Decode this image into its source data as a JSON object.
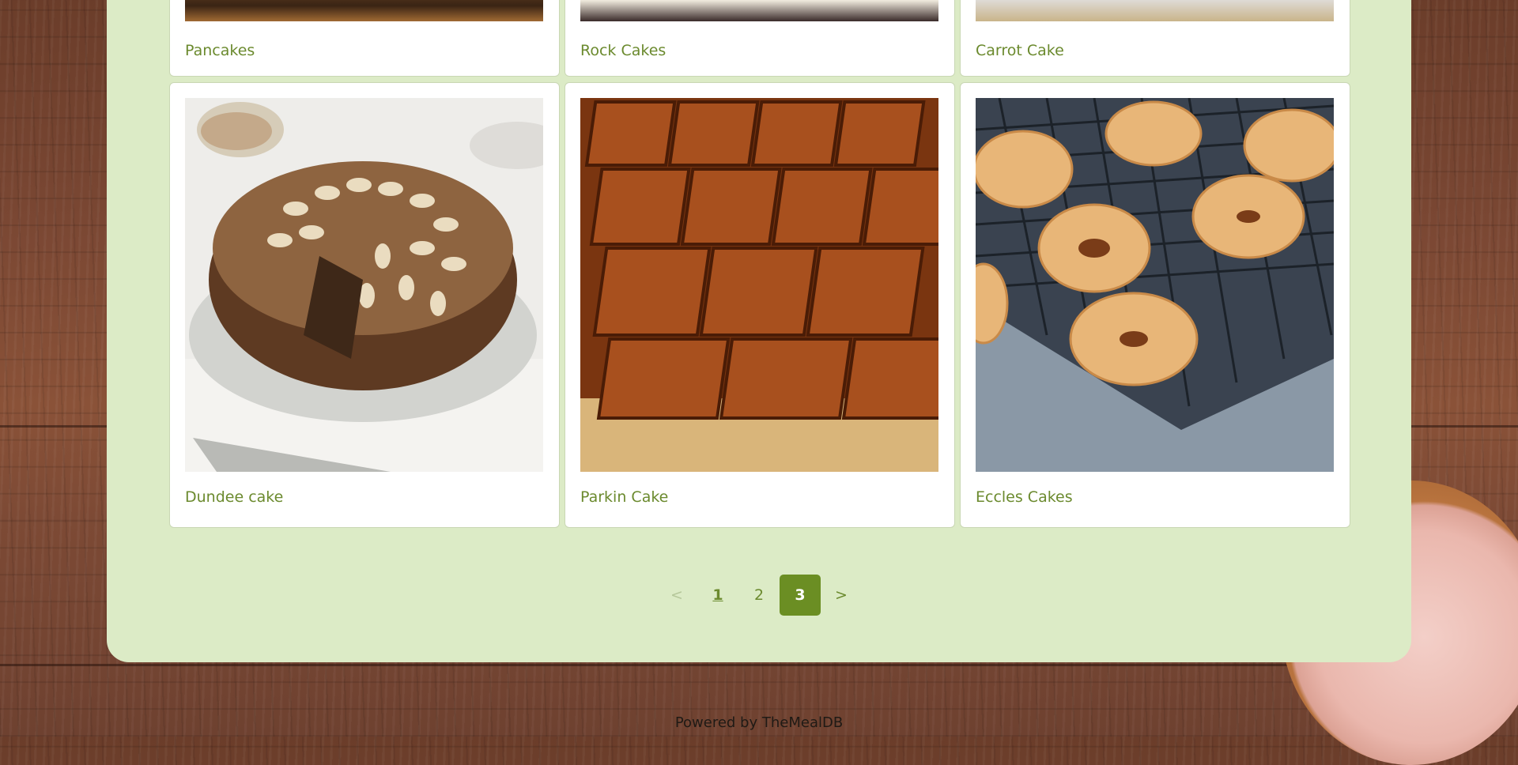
{
  "top_row": [
    {
      "title": "Pancakes"
    },
    {
      "title": "Rock Cakes"
    },
    {
      "title": "Carrot Cake"
    }
  ],
  "meals": [
    {
      "title": "Dundee cake"
    },
    {
      "title": "Parkin Cake"
    },
    {
      "title": "Eccles Cakes"
    }
  ],
  "pagination": {
    "prev": "<",
    "pages": [
      "1",
      "2",
      "3"
    ],
    "next": ">",
    "active_page": "3"
  },
  "footer": {
    "text": "Powered by TheMealDB"
  },
  "colors": {
    "panel": "#dcebc6",
    "accent": "#6b8e23",
    "link": "#6b8a2e"
  }
}
